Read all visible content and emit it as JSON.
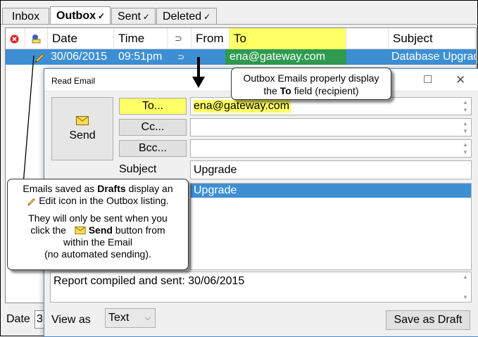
{
  "tabs": [
    {
      "label": "Inbox",
      "check": ""
    },
    {
      "label": "Outbox",
      "check": "✓"
    },
    {
      "label": "Sent",
      "check": "✓"
    },
    {
      "label": "Deleted",
      "check": "✓"
    }
  ],
  "columns": {
    "date": "Date",
    "time": "Time",
    "from": "From",
    "to": "To",
    "subject": "Subject"
  },
  "row": {
    "date": "30/06/2015",
    "time": "09:51pm",
    "to": "ena@gateway.com",
    "subject": "Database Upgrade"
  },
  "bottom": {
    "date_label": "Date",
    "date_value": "3"
  },
  "dialog": {
    "title": "Read Email",
    "send_label": "Send",
    "to_label": "To...",
    "cc_label": "Cc...",
    "bcc_label": "Bcc...",
    "to_value": "ena@gateway.com",
    "cc_value": "",
    "bcc_value": "",
    "subject_label": "Subject",
    "subject_value": "Upgrade",
    "body_first_line": "Upgrade",
    "body_line": "Report compiled and sent: 30/06/2015",
    "view_as_label": "View as",
    "view_as_value": "Text",
    "save_draft_label": "Save as Draft"
  },
  "callouts": {
    "outbox_line1": "Outbox Emails properly display",
    "outbox_line2_pre": "the",
    "outbox_line2_bold": "To",
    "outbox_line2_post": "field (recipient)",
    "drafts_l1_pre": "Emails saved as",
    "drafts_l1_bold": "Drafts",
    "drafts_l1_post": "display an",
    "drafts_l2": "Edit icon in the Outbox listing.",
    "drafts_l3": "They will only be sent when you",
    "drafts_l4_pre": "click the",
    "drafts_l4_bold": "Send",
    "drafts_l4_post": "button from",
    "drafts_l5": "within the Email",
    "drafts_l6": "(no automated sending)."
  },
  "colors": {
    "highlight": "#ffff66",
    "selection": "#3d8fd4",
    "to_cell_selected": "#2f9a50"
  }
}
